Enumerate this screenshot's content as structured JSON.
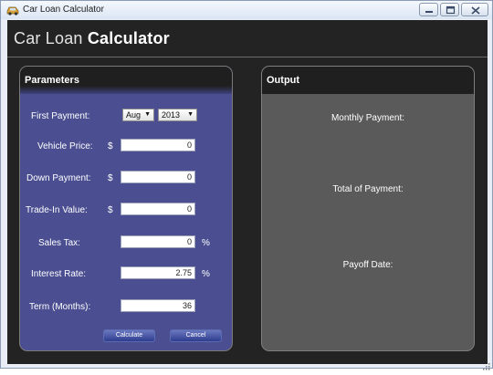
{
  "window": {
    "title": "Car Loan Calculator"
  },
  "header": {
    "title_light": "Car Loan ",
    "title_bold": "Calculator"
  },
  "parameters": {
    "heading": "Parameters",
    "first_payment": {
      "label": "First Payment:",
      "month": "Aug",
      "year": "2013"
    },
    "vehicle_price": {
      "label": "Vehicle Price:",
      "currency": "$",
      "value": "0"
    },
    "down_payment": {
      "label": "Down Payment:",
      "currency": "$",
      "value": "0"
    },
    "trade_in": {
      "label": "Trade-In Value:",
      "currency": "$",
      "value": "0"
    },
    "sales_tax": {
      "label": "Sales Tax:",
      "value": "0",
      "unit": "%"
    },
    "interest_rate": {
      "label": "Interest Rate:",
      "value": "2.75",
      "unit": "%"
    },
    "term": {
      "label": "Term (Months):",
      "value": "36"
    },
    "calculate_label": "Calculate",
    "cancel_label": "Cancel"
  },
  "output": {
    "heading": "Output",
    "monthly_payment": "Monthly Payment:",
    "total_payment": "Total of Payment:",
    "payoff_date": "Payoff Date:"
  },
  "colors": {
    "params_panel": "#4b4f92",
    "output_panel": "#5a5a5a",
    "client_bg": "#232323"
  }
}
